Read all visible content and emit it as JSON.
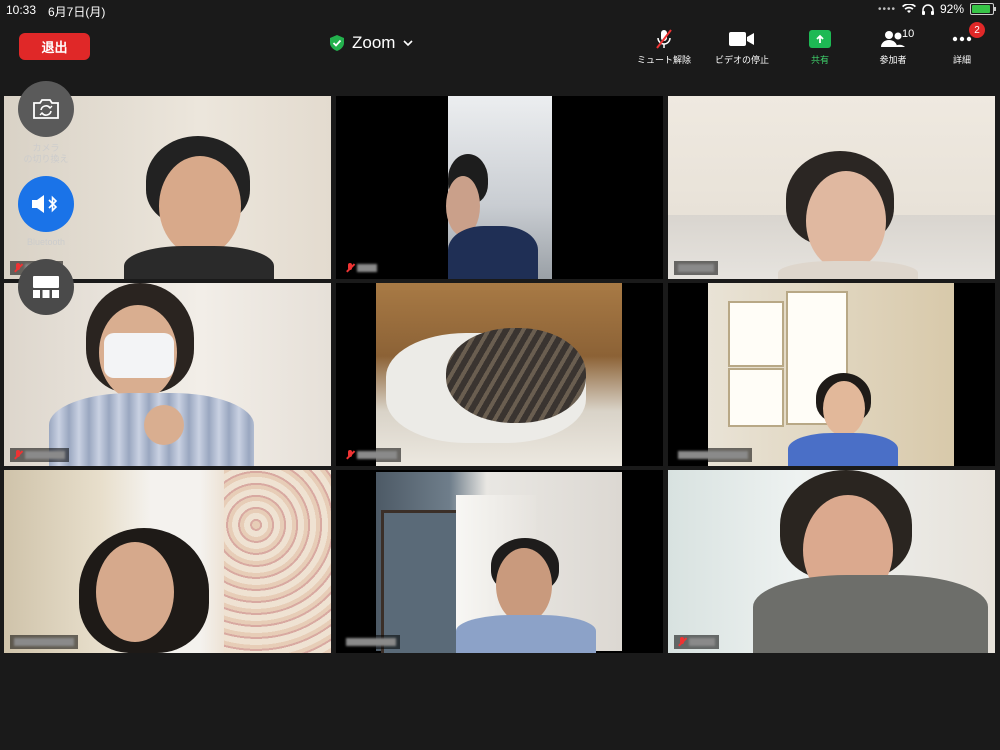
{
  "status_bar": {
    "time": "10:33",
    "date": "6月7日(月)",
    "battery": "92%",
    "battery_level": 0.92
  },
  "toolbar": {
    "leave_label": "退出",
    "title": "Zoom",
    "items": [
      {
        "label": "ミュート解除",
        "icon": "mic-muted-icon"
      },
      {
        "label": "ビデオの停止",
        "icon": "video-camera-icon"
      },
      {
        "label": "共有",
        "icon": "share-screen-icon"
      },
      {
        "label": "参加者",
        "icon": "participants-icon",
        "count": "10"
      },
      {
        "label": "詳細",
        "icon": "more-icon",
        "badge": "2"
      }
    ]
  },
  "floating": {
    "camera_switch_label": "カメラ\nの切り換え",
    "bluetooth_label": "Bluetooth"
  },
  "colors": {
    "leave": "#e02828",
    "share": "#1db954",
    "active_speaker": "#2bbd4c",
    "bluetooth": "#1a73e8"
  }
}
